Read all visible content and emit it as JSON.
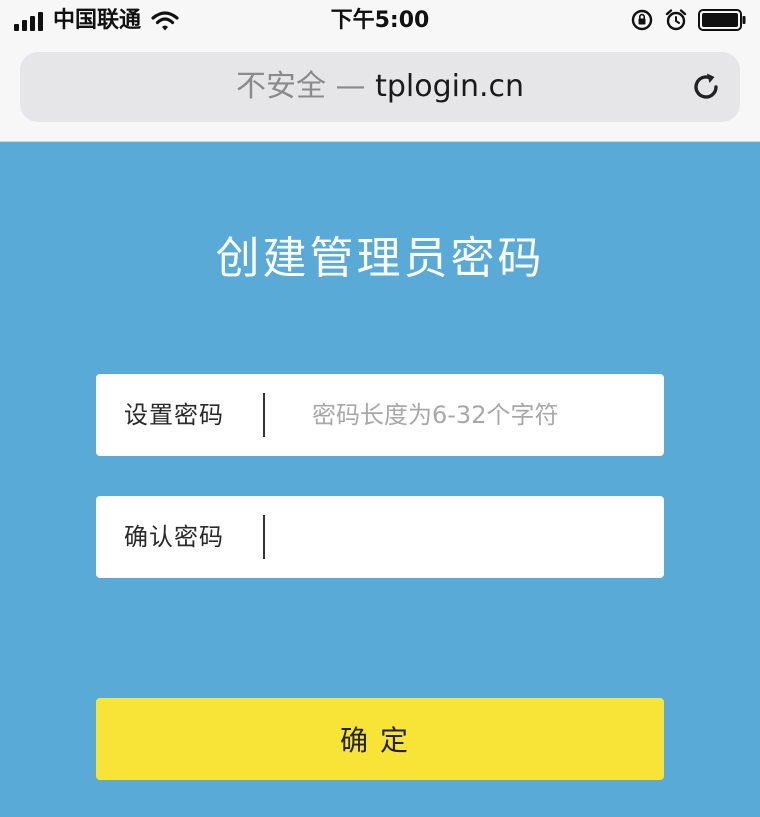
{
  "status_bar": {
    "carrier": "中国联通",
    "time": "下午5:00",
    "icons": [
      "signal-icon",
      "wifi-icon",
      "orientation-lock-icon",
      "alarm-icon",
      "battery-icon"
    ]
  },
  "browser": {
    "insecure_label": "不安全",
    "separator": "—",
    "host": "tplogin.cn",
    "reload_icon": "reload-icon"
  },
  "page": {
    "title": "创建管理员密码",
    "password_field": {
      "label": "设置密码",
      "value": "",
      "placeholder": "密码长度为6-32个字符"
    },
    "confirm_field": {
      "label": "确认密码",
      "value": "",
      "placeholder": ""
    },
    "confirm_button_label": "确定"
  },
  "colors": {
    "background": "#5aaad8",
    "button": "#f8e436",
    "field": "#ffffff",
    "chrome": "#f7f7f7"
  }
}
